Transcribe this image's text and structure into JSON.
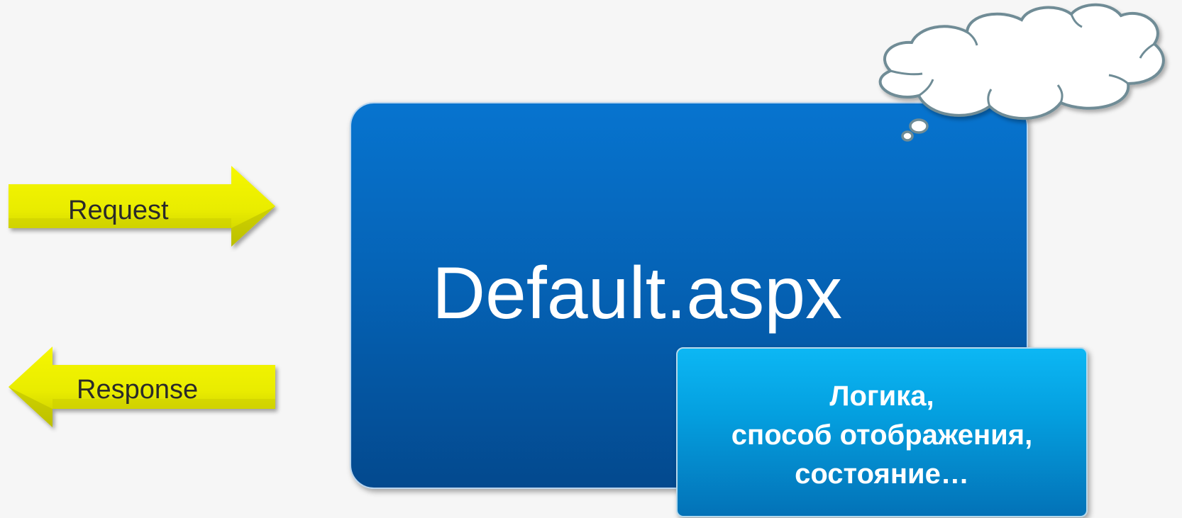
{
  "arrows": {
    "request_label": "Request",
    "response_label": "Response",
    "fill_color": "#eef000",
    "shade_color": "#a9a900"
  },
  "page": {
    "title": "Default.aspx",
    "color": "#0563b6"
  },
  "code_behind": {
    "lines": [
      "Логика,",
      "способ отображения,",
      "состояние…"
    ],
    "color": "#049fdf"
  },
  "thought_cloud": {
    "icon": "thought-cloud-icon",
    "outline_color": "#6f8c96"
  }
}
